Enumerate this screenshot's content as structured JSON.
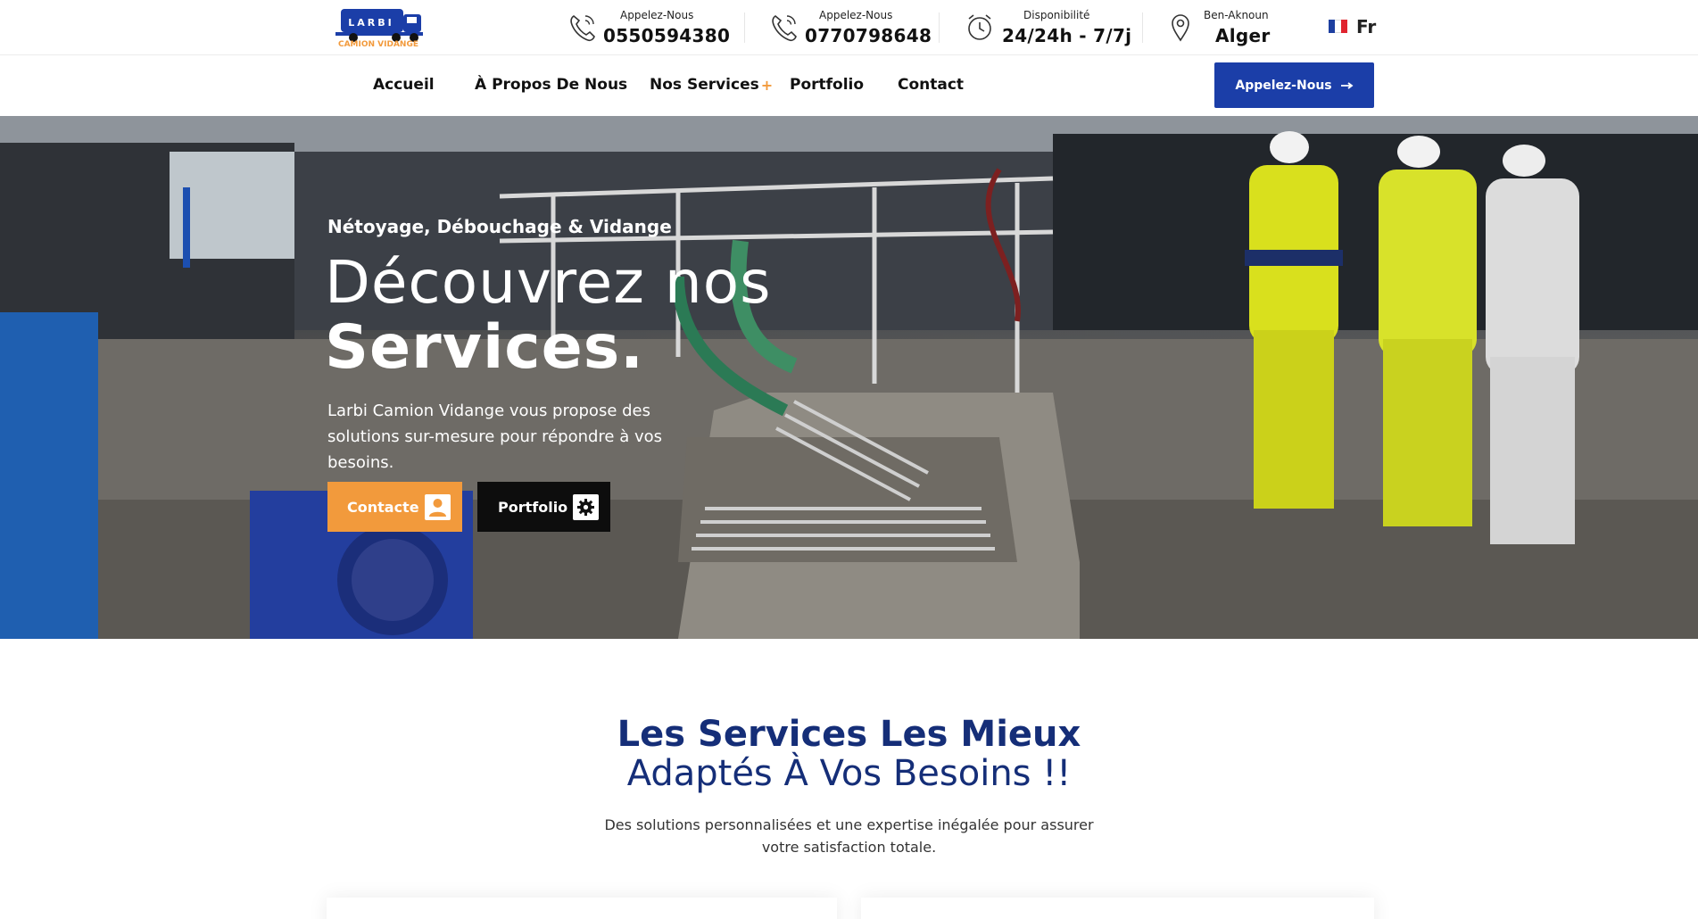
{
  "header": {
    "logo": {
      "brand": "LARBI",
      "sub": "CAMION VIDANGE"
    },
    "phone1": {
      "label": "Appelez-Nous",
      "value": "0550594380",
      "icon": "phone-icon"
    },
    "phone2": {
      "label": "Appelez-Nous",
      "value": "0770798648",
      "icon": "phone-icon"
    },
    "availability": {
      "label": "Disponibilité",
      "value": "24/24h - 7/7j",
      "icon": "alarm-clock-icon"
    },
    "location": {
      "label": "Ben-Aknoun",
      "value": "Alger",
      "icon": "map-pin-icon"
    },
    "language": {
      "label": "Fr",
      "icon": "france-flag-icon"
    }
  },
  "nav": {
    "items": [
      {
        "label": "Accueil"
      },
      {
        "label": "À Propos De Nous"
      },
      {
        "label": "Nos Services",
        "submenu_marker": "+"
      },
      {
        "label": "Portfolio"
      },
      {
        "label": "Contact"
      }
    ],
    "cta": {
      "label": "Appelez-Nous",
      "icon": "arrow-right-icon"
    }
  },
  "hero": {
    "kicker": "Nétoyage, Débouchage & Vidange",
    "title_line1": "Découvrez nos",
    "title_line2": "Services.",
    "description": "Larbi Camion Vidange vous propose des solutions sur-mesure pour répondre à vos besoins.",
    "buttons": [
      {
        "label": "Contacte",
        "icon": "user-icon"
      },
      {
        "label": "Portfolio",
        "icon": "gear-icon"
      }
    ]
  },
  "services": {
    "title_bold": "Les Services Les Mieux",
    "title_regular": "Adaptés À Vos Besoins !!",
    "description": "Des solutions personnalisées et une expertise inégalée pour assurer votre satisfaction totale."
  },
  "colors": {
    "brand_blue": "#1b3ea8",
    "heading_navy": "#152e78",
    "accent_orange": "#f29a3c",
    "dark_button": "#0d0d0d"
  }
}
